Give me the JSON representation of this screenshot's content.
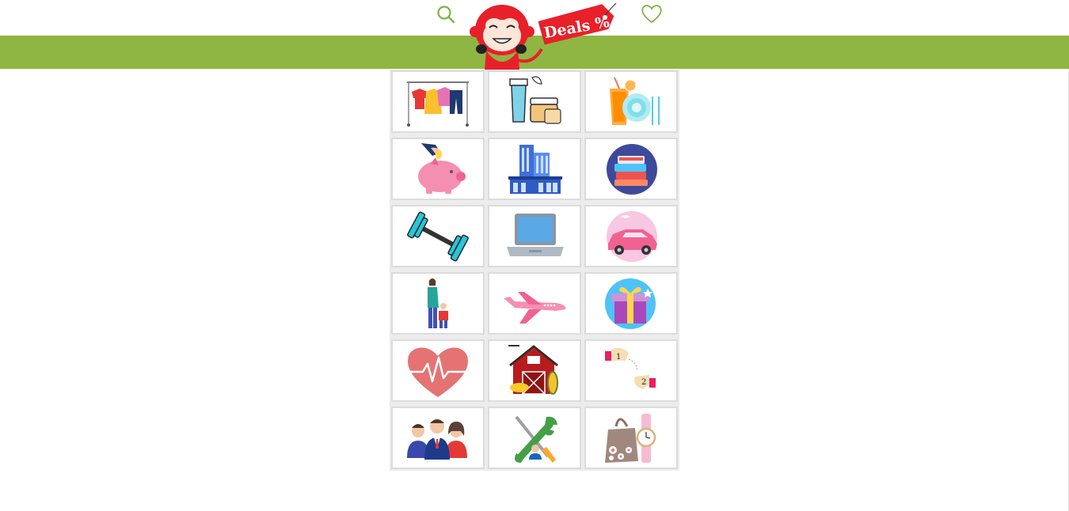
{
  "header": {
    "logo_text": "Deals %",
    "search_icon": "search-icon",
    "favorites_icon": "heart-icon",
    "accent_color": "#8fb543",
    "logo_red": "#e8202a"
  },
  "categories": [
    {
      "icon": "clothing-rack-icon"
    },
    {
      "icon": "cosmetics-icon"
    },
    {
      "icon": "food-drink-icon"
    },
    {
      "icon": "piggy-bank-icon"
    },
    {
      "icon": "buildings-icon"
    },
    {
      "icon": "books-icon"
    },
    {
      "icon": "dumbbell-icon"
    },
    {
      "icon": "laptop-icon"
    },
    {
      "icon": "car-icon"
    },
    {
      "icon": "mother-child-icon"
    },
    {
      "icon": "airplane-icon"
    },
    {
      "icon": "gift-icon"
    },
    {
      "icon": "heartbeat-icon"
    },
    {
      "icon": "barn-icon"
    },
    {
      "icon": "handshake-steps-icon"
    },
    {
      "icon": "people-group-icon"
    },
    {
      "icon": "tools-icon"
    },
    {
      "icon": "bag-watch-icon"
    }
  ]
}
